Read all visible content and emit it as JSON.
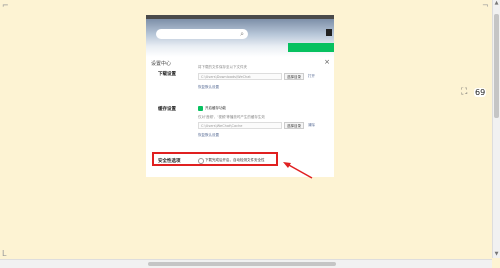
{
  "window": {
    "corner_glyph": "⌐",
    "scroll_up": "▲",
    "scroll_down": "▼"
  },
  "app": {
    "search_icon": "search-icon",
    "settings": {
      "title": "设置中心",
      "close": "×",
      "download": {
        "label": "下载设置",
        "hint": "将下载的文件保存至以下文件夹",
        "path": "C:\\Users\\Downloads\\WeChat",
        "change_button": "选择目录",
        "open_link": "打开",
        "default_link": "恢复默认设置"
      },
      "cache": {
        "label": "缓存设置",
        "enable_text": "开启缓存功能",
        "hint": "仅对'音频'，'视频'等播放时产生的缓存生效",
        "path": "C:\\Users\\WeChat\\Cache",
        "change_button": "选择目录",
        "clear_link": "清除",
        "default_link": "恢复默认设置"
      },
      "security": {
        "label": "安全性选项",
        "option_text": "下载完成后开启，自动检测文件安全性"
      }
    }
  },
  "zoom": {
    "icon": "zoom-icon",
    "value": "69"
  },
  "annotation": {
    "arrow_color": "#e02020"
  }
}
